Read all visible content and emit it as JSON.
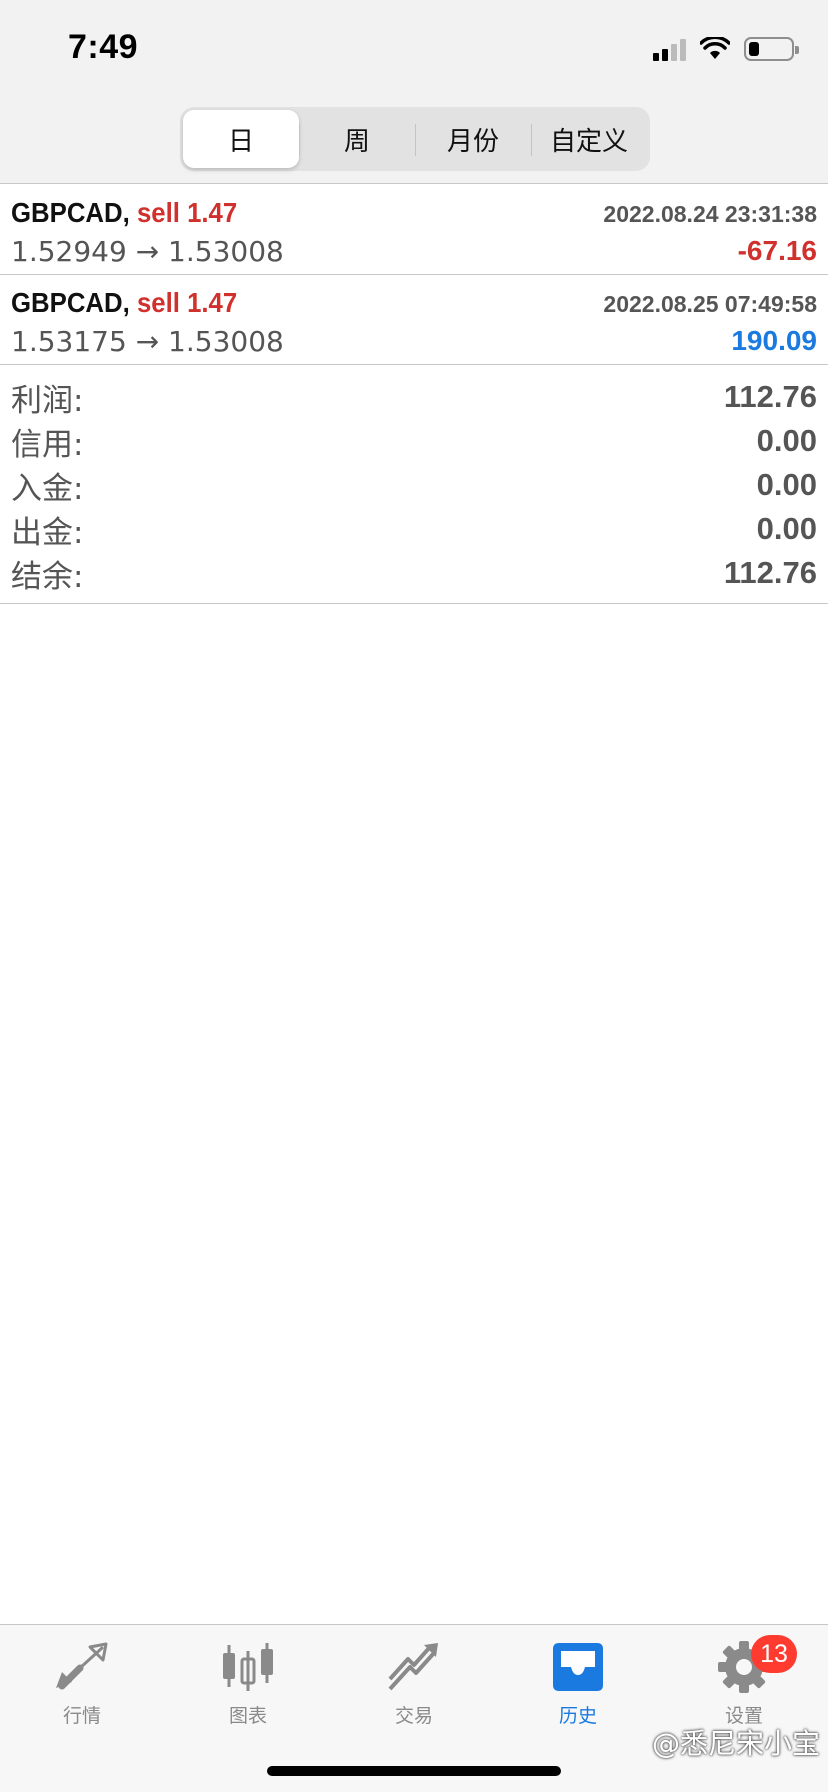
{
  "status_bar": {
    "time": "7:49"
  },
  "period_tabs": [
    {
      "label": "日",
      "active": true
    },
    {
      "label": "周",
      "active": false
    },
    {
      "label": "月份",
      "active": false
    },
    {
      "label": "自定义",
      "active": false
    }
  ],
  "trades": [
    {
      "symbol": "GBPCAD,",
      "side_volume": "sell 1.47",
      "time": "2022.08.24 23:31:38",
      "prices": "1.52949 → 1.53008",
      "profit": "-67.16"
    },
    {
      "symbol": "GBPCAD,",
      "side_volume": "sell 1.47",
      "time": "2022.08.25 07:49:58",
      "prices": "1.53175 → 1.53008",
      "profit": "190.09"
    }
  ],
  "summary": [
    {
      "label": "利润:",
      "value": "112.76"
    },
    {
      "label": "信用:",
      "value": "0.00"
    },
    {
      "label": "入金:",
      "value": "0.00"
    },
    {
      "label": "出金:",
      "value": "0.00"
    },
    {
      "label": "结余:",
      "value": "112.76"
    }
  ],
  "tab_bar": [
    {
      "label": "行情",
      "icon": "quotes-arrows-icon"
    },
    {
      "label": "图表",
      "icon": "candlestick-chart-icon"
    },
    {
      "label": "交易",
      "icon": "trade-trend-icon"
    },
    {
      "label": "历史",
      "icon": "history-inbox-icon",
      "active": true
    },
    {
      "label": "设置",
      "icon": "gear-icon",
      "badge": "13"
    }
  ],
  "watermark": "@悉尼宋小宝",
  "colors": {
    "loss": "#d0312d",
    "gain": "#1a7ae0",
    "accent": "#1a7ae0",
    "badge": "#ff3b30"
  }
}
